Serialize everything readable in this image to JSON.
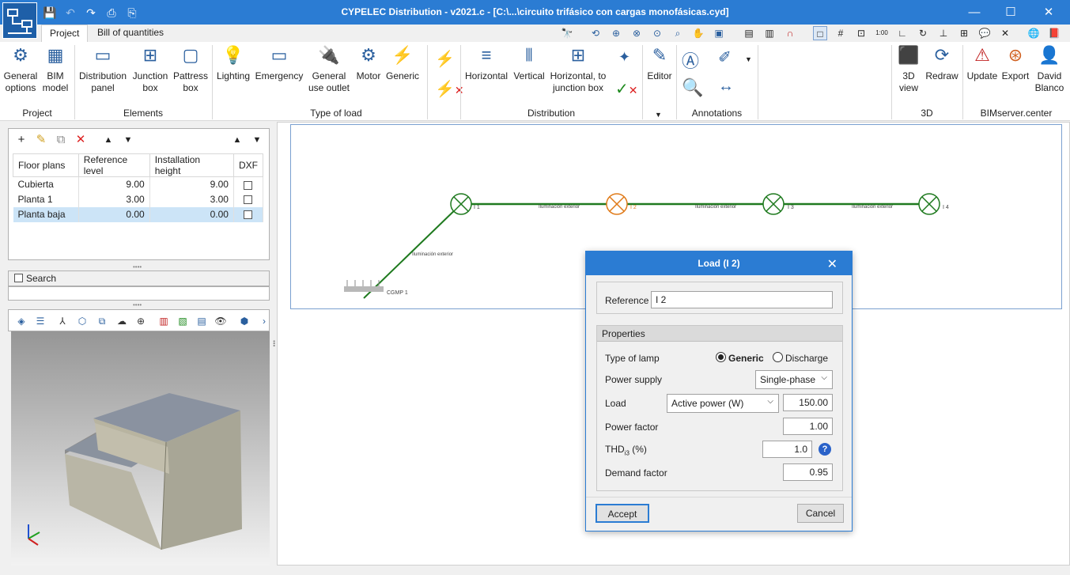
{
  "window": {
    "title": "CYPELEC Distribution - v2021.c - [C:\\...\\circuito trifásico con cargas monofásicas.cyd]"
  },
  "tabs": [
    "Project",
    "Bill of quantities"
  ],
  "ribbon": {
    "buttons": {
      "general": [
        "General",
        "options"
      ],
      "bim": [
        "BIM",
        "model"
      ],
      "distpanel": [
        "Distribution",
        "panel"
      ],
      "junction": [
        "Junction",
        "box"
      ],
      "pattress": [
        "Pattress",
        "box"
      ],
      "lighting": "Lighting",
      "emergency": "Emergency",
      "gen_outlet": [
        "General",
        "use outlet"
      ],
      "motor": "Motor",
      "generic": "Generic",
      "horizontal": "Horizontal",
      "vertical": "Vertical",
      "horiz_jb": [
        "Horizontal, to",
        "junction box"
      ],
      "editor": "Editor",
      "view3d": [
        "3D",
        "view"
      ],
      "redraw": "Redraw",
      "update": "Update",
      "export": "Export",
      "user": [
        "David",
        "Blanco"
      ]
    },
    "groups": {
      "project": "Project",
      "elements": "Elements",
      "type_of_load": "Type of load",
      "distribution": "Distribution",
      "annotations": "Annotations",
      "g3d": "3D",
      "bimserver": "BIMserver.center"
    }
  },
  "floor_plans": {
    "headers": [
      "Floor plans",
      "Reference level",
      "Installation height",
      "DXF"
    ],
    "rows": [
      {
        "name": "Cubierta",
        "ref": "9.00",
        "height": "9.00",
        "dxf": false
      },
      {
        "name": "Planta 1",
        "ref": "3.00",
        "height": "3.00",
        "dxf": false
      },
      {
        "name": "Planta baja",
        "ref": "0.00",
        "height": "0.00",
        "dxf": false
      }
    ]
  },
  "search": {
    "label": "Search"
  },
  "plan": {
    "labels": {
      "l1": "I 1",
      "l2": "I 2",
      "l3": "I 3",
      "l4": "I 4",
      "cgmp": "CGMP 1",
      "seg": "Iluminación exterior"
    }
  },
  "dialog": {
    "title": "Load (I 2)",
    "reference_label": "Reference",
    "reference_value": "I 2",
    "properties_label": "Properties",
    "lamp_label": "Type of lamp",
    "lamp_generic": "Generic",
    "lamp_discharge": "Discharge",
    "supply_label": "Power supply",
    "supply_value": "Single-phase",
    "load_label": "Load",
    "load_type": "Active power (W)",
    "load_value": "150.00",
    "pf_label": "Power factor",
    "pf_value": "1.00",
    "thd_label": "THD",
    "thd_sub": "i3",
    "thd_unit": " (%)",
    "thd_value": "1.0",
    "demand_label": "Demand factor",
    "demand_value": "0.95",
    "accept": "Accept",
    "cancel": "Cancel"
  },
  "colors": {
    "accent": "#2b7cd3",
    "circuit": "#1f7a1f",
    "selected_load": "#e07b1a"
  }
}
